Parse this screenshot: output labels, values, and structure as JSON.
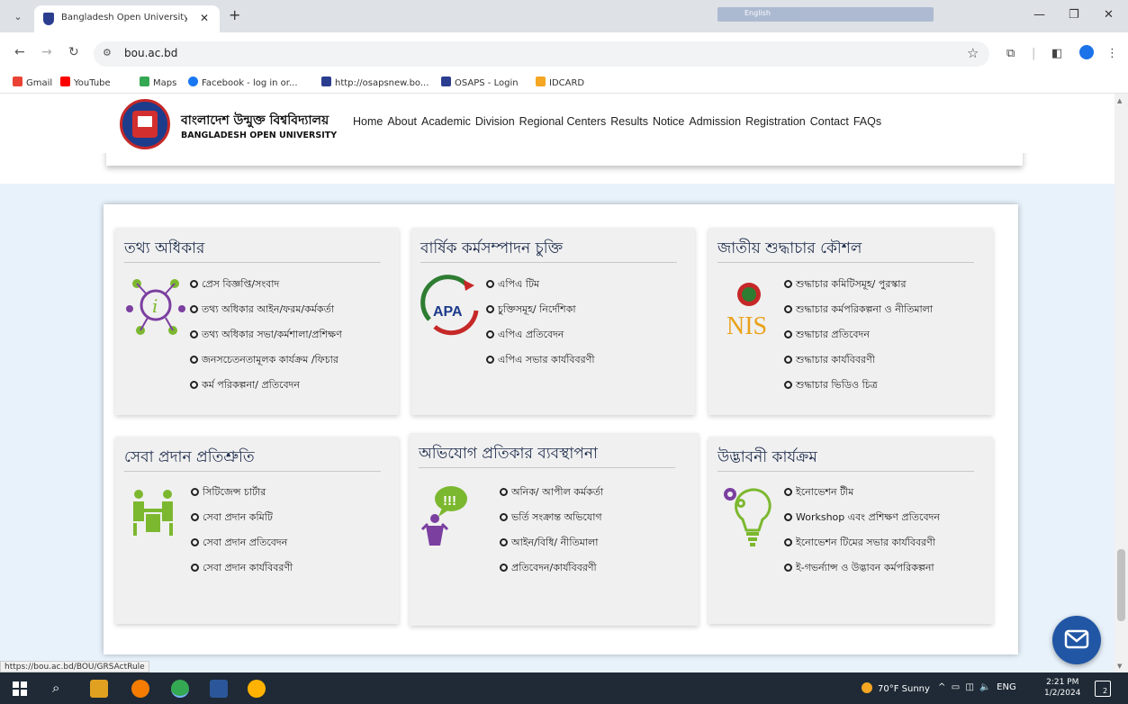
{
  "browser": {
    "tab_title": "Bangladesh Open University (B…",
    "tab_close": "✕",
    "new_tab": "+",
    "url": "bou.ac.bd",
    "ime_label": "English",
    "bookmarks": [
      "Gmail",
      "YouTube",
      "Maps",
      "Facebook - log in or...",
      "http://osapsnew.bo...",
      "OSAPS - Login",
      "IDCARD"
    ],
    "status_url": "https://bou.ac.bd/BOU/GRSActRule"
  },
  "site": {
    "brand_bn": "বাংলাদেশ উন্মুক্ত বিশ্ববিদ্যালয়",
    "brand_en": "BANGLADESH OPEN UNIVERSITY",
    "menu": [
      "Home",
      "About",
      "Academic",
      "Division",
      "Regional Centers",
      "Results",
      "Notice",
      "Admission",
      "Registration",
      "Contact",
      "FAQs"
    ]
  },
  "panels": [
    {
      "title": "তথ্য অধিকার",
      "icon": "info-network-icon",
      "items": [
        "প্রেস বিজ্ঞপ্তি/সংবাদ",
        "তথ্য অধিকার আইন/ফরম/কর্মকর্তা",
        "তথ্য অধিকার সভা/কর্মশালা/প্রশিক্ষণ",
        "জনসচেতনতামূলক কার্যক্রম /ফিচার",
        "কর্ম পরিকল্পনা/ প্রতিবেদন"
      ]
    },
    {
      "title": "বার্ষিক কর্মসম্পাদন চুক্তি",
      "icon": "apa-logo-icon",
      "icon_text": "APA",
      "items": [
        "এপিএ টিম",
        "চুক্তিসমূহ/ নির্দেশিকা",
        "এপিএ প্রতিবেদন",
        "এপিএ সভার কার্যবিবরণী"
      ]
    },
    {
      "title": "জাতীয় শুদ্ধাচার কৌশল",
      "icon": "nis-logo-icon",
      "icon_text": "NIS",
      "items": [
        "শুদ্ধাচার কমিটিসমূহ/ পুরস্কার",
        "শুদ্ধাচার কর্মপরিকল্পনা ও নীতিমালা",
        "শুদ্ধাচার প্রতিবেদন",
        "শুদ্ধাচার কার্যবিবরণী",
        "শুদ্ধাচার ভিডিও চিত্র"
      ]
    },
    {
      "title": "সেবা প্রদান প্রতিশ্রুতি",
      "icon": "meeting-people-icon",
      "items": [
        "সিটিজেন্স চার্টার",
        "সেবা প্রদান কমিটি",
        "সেবা প্রদান প্রতিবেদন",
        "সেবা প্রদান কার্যবিবরণী"
      ]
    },
    {
      "title": "অভিযোগ প্রতিকার ব্যবস্থাপনা",
      "icon": "complaint-speech-icon",
      "icon_text": "!!!",
      "items": [
        "অনিক/ আপীল কর্মকর্তা",
        "ভর্তি সংক্রান্ত অভিযোগ",
        "আইন/বিধি/ নীতিমালা",
        "প্রতিবেদন/কার্যবিবরণী"
      ]
    },
    {
      "title": "উদ্ভাবনী কার্যক্রম",
      "icon": "innovation-bulb-icon",
      "items": [
        "ইনোভেশন টীম",
        "Workshop এবং প্রশিক্ষণ প্রতিবেদন",
        "ইনোভেশন টিমের সভার কার্যবিবরণী",
        "ই-গভর্ন্যান্স ও উদ্ভাবন কর্মপরিকল্পনা"
      ]
    }
  ],
  "taskbar": {
    "weather": "70°F  Sunny",
    "lang": "ENG",
    "time": "2:21 PM",
    "date": "1/2/2024",
    "notif_count": "2"
  },
  "colors": {
    "accent_blue": "#2156a5",
    "icon_green": "#7cb82f",
    "icon_purple": "#7b3fa0",
    "band_bg": "#e8f2fb"
  }
}
